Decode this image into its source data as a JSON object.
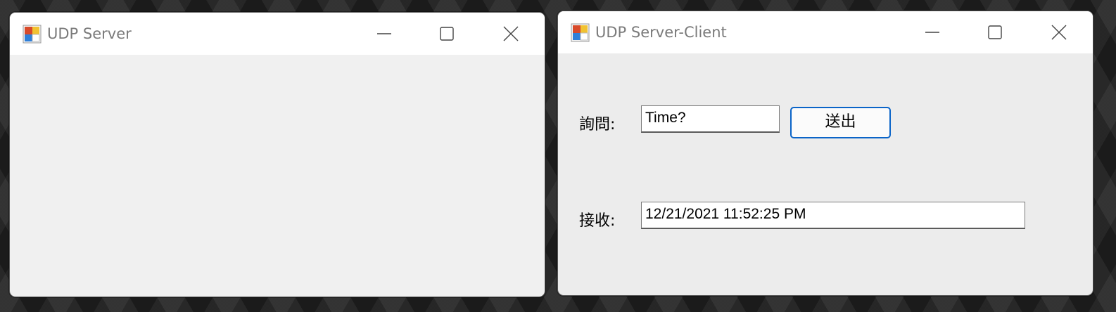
{
  "server_window": {
    "title": "UDP Server",
    "icon": "winforms-app-icon",
    "controls": [
      "minimize-icon",
      "maximize-icon",
      "close-icon"
    ]
  },
  "client_window": {
    "title": "UDP Server-Client",
    "icon": "winforms-app-icon",
    "controls": [
      "minimize-icon",
      "maximize-icon",
      "close-icon"
    ],
    "query_label": "詢問:",
    "query_value": "Time?",
    "send_label": "送出",
    "receive_label": "接收:",
    "receive_value": "12/21/2021 11:52:25 PM"
  },
  "colors": {
    "accent_button_border": "#0a64c8",
    "window_body": "#f0f0f0",
    "titlebar": "#ffffff",
    "title_text": "#7a7a7a"
  }
}
